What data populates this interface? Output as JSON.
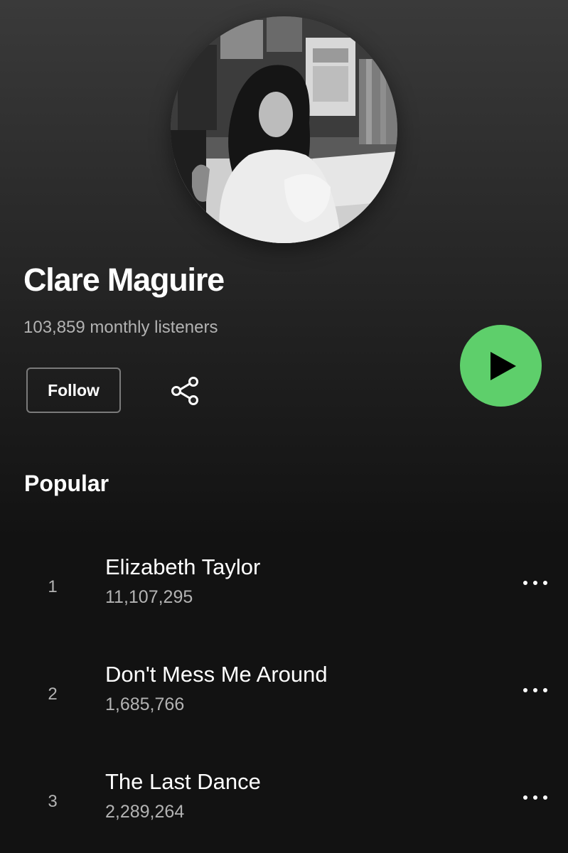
{
  "artist": {
    "name": "Clare Maguire",
    "monthly_listeners": "103,859 monthly listeners"
  },
  "actions": {
    "follow_label": "Follow",
    "share_icon": "share-icon",
    "play_icon": "play-icon",
    "play_color": "#5ecf6b"
  },
  "popular": {
    "title": "Popular",
    "tracks": [
      {
        "number": "1",
        "title": "Elizabeth Taylor",
        "plays": "11,107,295"
      },
      {
        "number": "2",
        "title": "Don't Mess Me Around",
        "plays": "1,685,766"
      },
      {
        "number": "3",
        "title": "The Last Dance",
        "plays": "2,289,264"
      }
    ],
    "more_icon": "more-options-icon"
  },
  "colors": {
    "background": "#121212",
    "text_primary": "#ffffff",
    "text_secondary": "#b3b3b3",
    "accent": "#5ecf6b"
  }
}
